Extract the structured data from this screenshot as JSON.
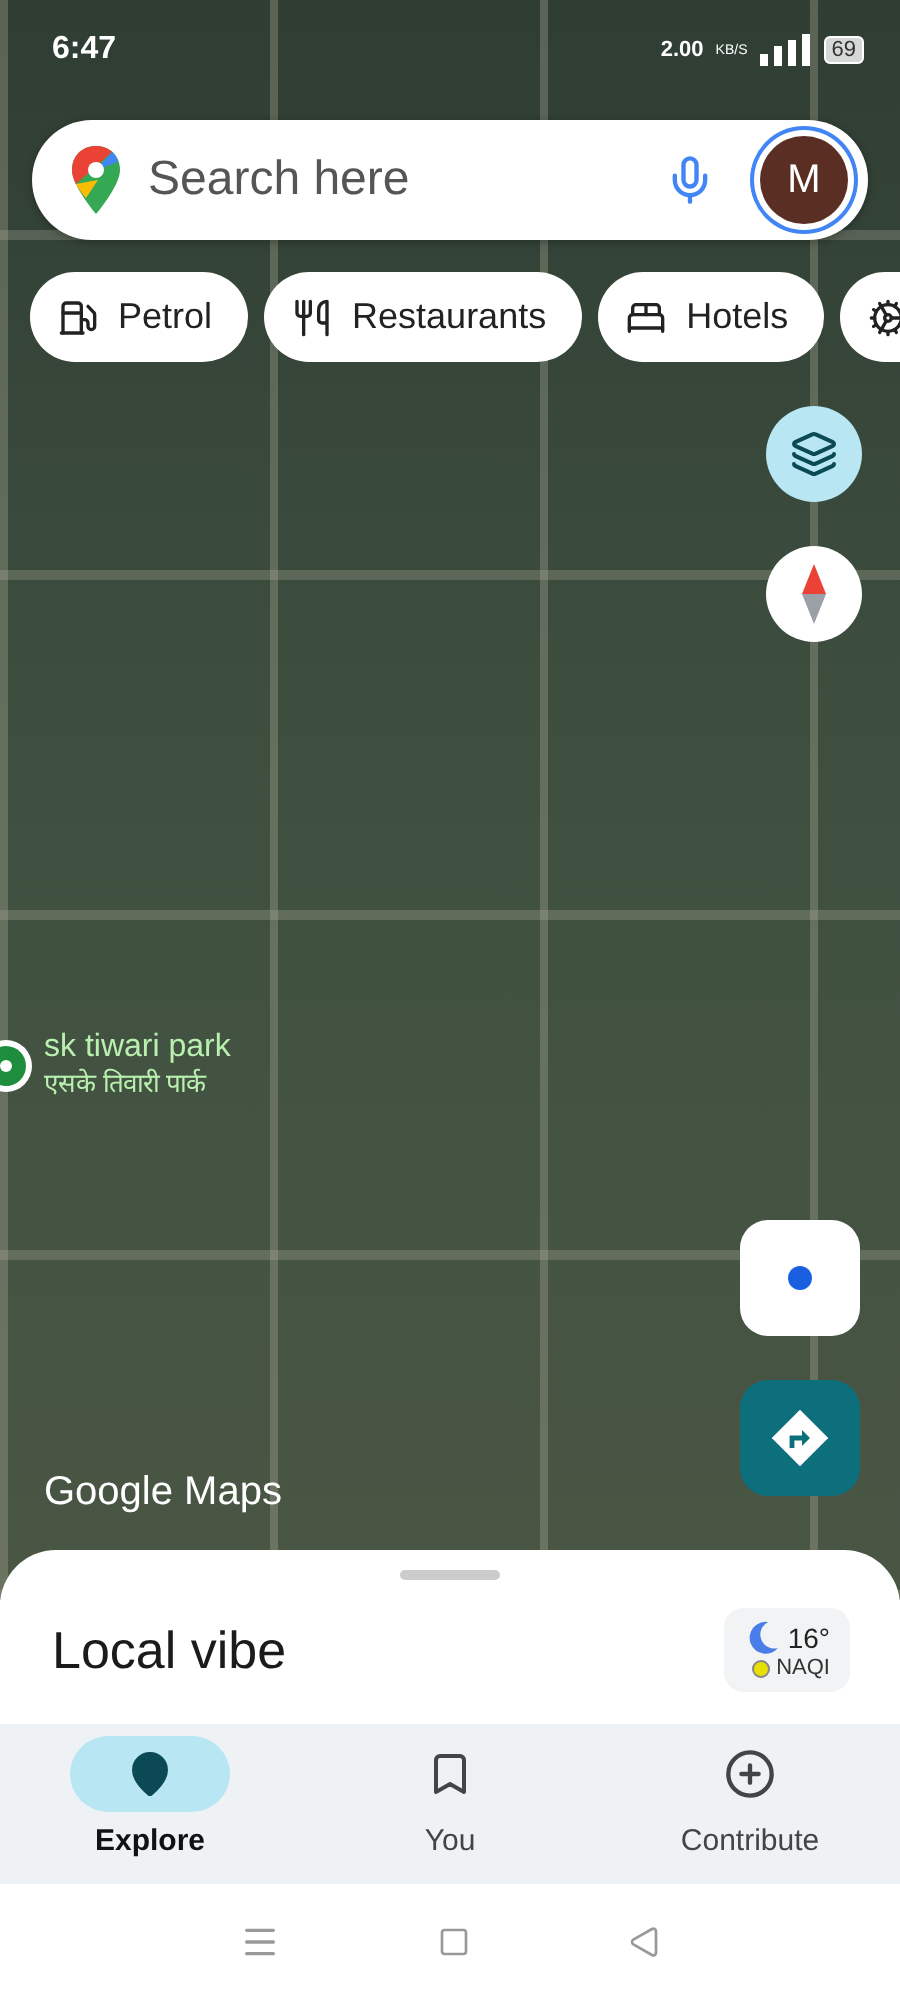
{
  "status_bar": {
    "time": "6:47",
    "speed": "2.00",
    "speed_unit": "KB/S",
    "battery": "69"
  },
  "search": {
    "placeholder": "Search here",
    "avatar": "M"
  },
  "chips": [
    {
      "label": "Petrol",
      "kind": "fuel"
    },
    {
      "label": "Restaurants",
      "kind": "food"
    },
    {
      "label": "Hotels",
      "kind": "bed"
    },
    {
      "kind": "service"
    }
  ],
  "map": {
    "place": {
      "name": "sk tiwari park",
      "name_local": "एसके तिवारी पार्क"
    },
    "logo": "Google Maps"
  },
  "sheet": {
    "title": "Local vibe",
    "weather": {
      "temp": "16°",
      "aqi": "NAQI"
    }
  },
  "nav": [
    {
      "label": "Explore",
      "kind": "explore",
      "selected": true
    },
    {
      "label": "You",
      "kind": "saved",
      "selected": false
    },
    {
      "label": "Contribute",
      "kind": "contribute",
      "selected": false
    }
  ]
}
